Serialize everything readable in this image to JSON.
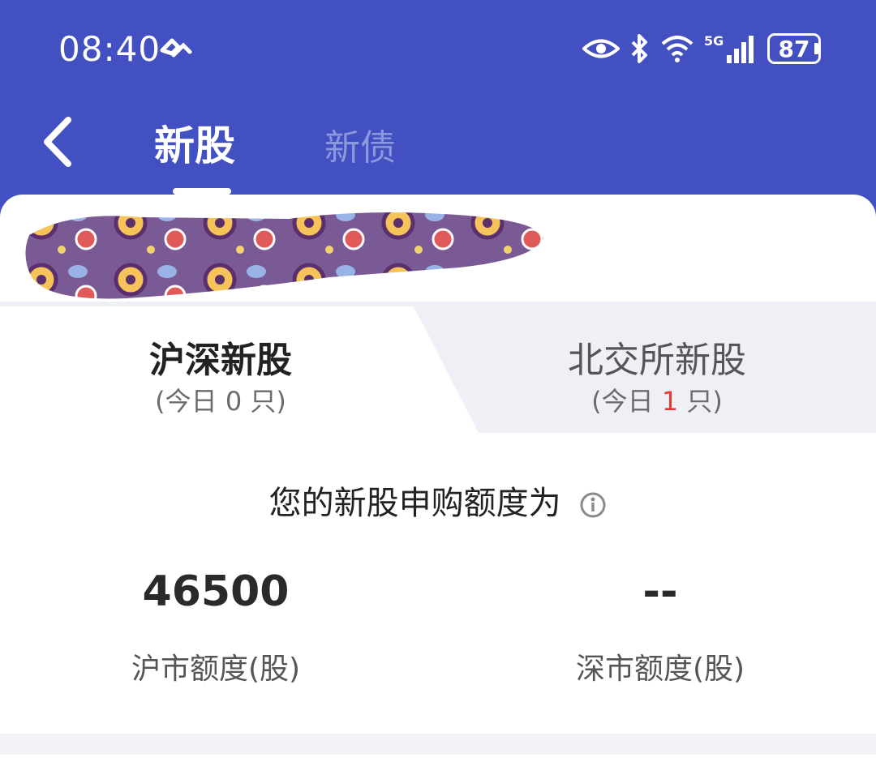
{
  "status_bar": {
    "time": "08:40",
    "battery": "87",
    "network": "5G"
  },
  "header": {
    "tabs": [
      {
        "label": "新股",
        "active": true
      },
      {
        "label": "新债",
        "active": false
      }
    ]
  },
  "market_tabs": [
    {
      "title": "沪深新股",
      "sub_prefix": "(今日",
      "count": "0",
      "sub_suffix": "只)",
      "active": true
    },
    {
      "title": "北交所新股",
      "sub_prefix": "(今日",
      "count": "1",
      "sub_suffix": "只)",
      "active": false
    }
  ],
  "quota": {
    "title": "您的新股申购额度为",
    "shanghai": {
      "value": "46500",
      "label": "沪市额度(股)"
    },
    "shenzhen": {
      "value": "--",
      "label": "深市额度(股)"
    }
  },
  "colors": {
    "header_bg": "#4350c2",
    "active_tab": "#ffffff",
    "inactive_tab": "#8e98dc",
    "highlight_count": "#e53935"
  }
}
